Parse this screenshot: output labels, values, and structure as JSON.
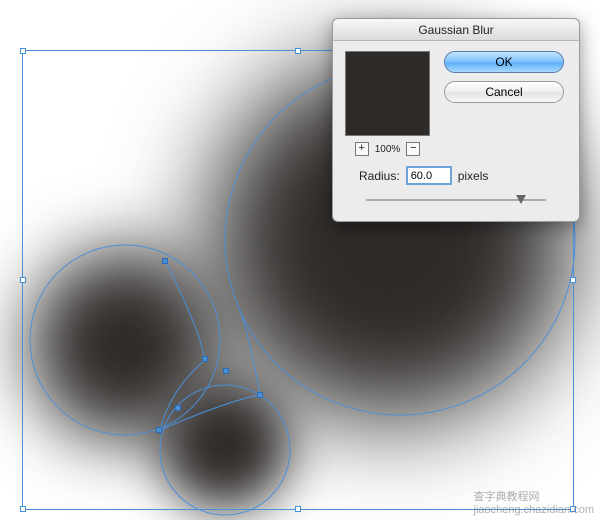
{
  "dialog": {
    "title": "Gaussian Blur",
    "ok_label": "OK",
    "cancel_label": "Cancel",
    "zoom_percent": "100%",
    "zoom_in_icon": "+",
    "zoom_out_icon": "−",
    "radius_label": "Radius:",
    "radius_value": "60.0",
    "radius_unit": "pixels",
    "preview_color": "#2d2a28"
  },
  "selection": {
    "stroke": "#4a90d9"
  },
  "watermark": {
    "text_cn": "查字典教程网",
    "text_url": "jiaocheng.chazidian.com"
  }
}
